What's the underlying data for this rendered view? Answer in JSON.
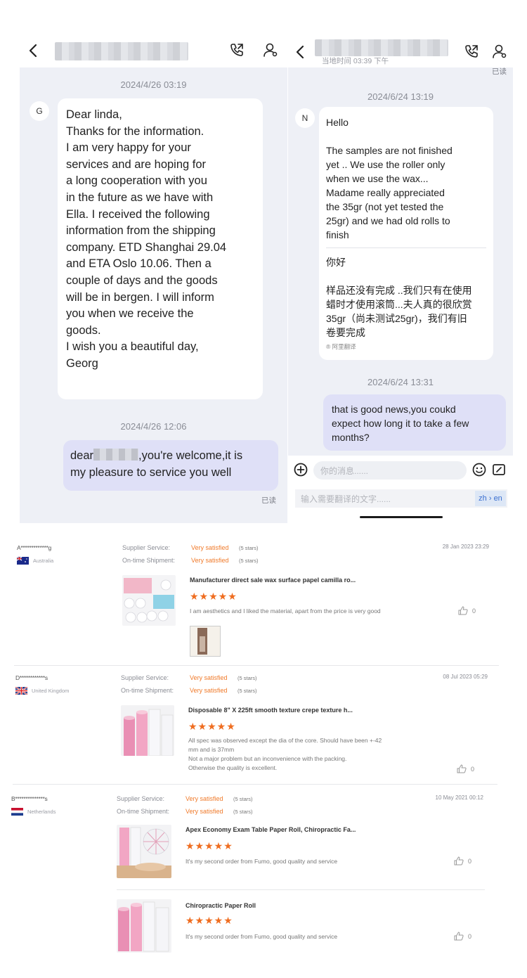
{
  "left_chat": {
    "avatar_initial": "G",
    "msg1_time": "2024/4/26 03:19",
    "msg1_text": "Dear linda,\nThanks for the information.\nI am very happy for your\nservices and are hoping for\na long cooperation with you\nin the future as we have with\nElla. I received the following\ninformation from the shipping\ncompany. ETD Shanghai 29.04\nand ETA Oslo 10.06. Then a\ncouple of days and the goods\nwill be in bergen. I will inform\nyou when we receive the\ngoods.\nI wish you a beautiful day,\nGeorg",
    "msg2_time": "2024/4/26 12:06",
    "msg2_prefix": "dear",
    "msg2_rest": ",you're welcome,it is",
    "msg2_line2": "my pleasure to service you well",
    "read_label": "已读"
  },
  "right_chat": {
    "sub_header": "当地时间 03:39 下午",
    "read_label_top": "已读",
    "avatar_initial": "N",
    "msg1_time": "2024/6/24 13:19",
    "msg1_en": "Hello\n\nThe samples are not finished\nyet .. We use the roller only\nwhen we use the wax...\nMadame really appreciated\nthe 35gr (not yet tested the\n25gr) and we had old rolls to\nfinish",
    "msg1_zh": "你好\n\n样品还没有完成 ..我们只有在使用\n蜡时才使用滚筒...夫人真的很欣赏\n35gr（尚未测试25gr)，我们有旧\n卷要完成",
    "translate_tag": "® 阿里翻译",
    "msg2_time": "2024/6/24 13:31",
    "msg2_text": "that is good news,you coukd\nexpect how long it to take a few\nmonths?",
    "input_placeholder": "你的消息......",
    "translate_placeholder": "输入需要翻译的文字......",
    "lang_toggle": "zh › en"
  },
  "reviews": [
    {
      "name": "A*************g",
      "country": "Australia",
      "supplier_label": "Supplier Service:",
      "supplier_value": "Very satisfied",
      "supplier_stars": "(5 stars)",
      "shipment_label": "On-time Shipment:",
      "shipment_value": "Very satisfied",
      "shipment_stars": "(5 stars)",
      "date": "28 Jan 2023 23:29",
      "product": "Manufacturer direct sale wax surface papel camilla ro...",
      "stars": "★★★★★",
      "text": "I am aesthetics and I liked the material, apart from the price is very good",
      "likes": "0"
    },
    {
      "name": "D************s",
      "country": "United Kingdom",
      "supplier_label": "Supplier Service:",
      "supplier_value": "Very satisfied",
      "supplier_stars": "(5 stars)",
      "shipment_label": "On-time Shipment:",
      "shipment_value": "Very satisfied",
      "shipment_stars": "(5 stars)",
      "date": "08 Jul 2023 05:29",
      "product": "Disposable 8\" X 225ft smooth texture crepe texture h...",
      "stars": "★★★★★",
      "text": "All spec was observed except the dia of the core. Should have been +-42\nmm and is 37mm\nNot a major problem but an inconvenience with the packing.\nOtherwise the quality is excellent.",
      "likes": "0"
    },
    {
      "name": "B**************s",
      "country": "Netherlands",
      "supplier_label": "Supplier Service:",
      "supplier_value": "Very satisfied",
      "supplier_stars": "(5 stars)",
      "shipment_label": "On-time Shipment:",
      "shipment_value": "Very satisfied",
      "shipment_stars": "(5 stars)",
      "date": "10 May 2021 00:12",
      "product": "Apex Economy Exam Table Paper Roll, Chiropractic Fa...",
      "stars": "★★★★★",
      "text": "It's my second order from Fumo, good quality and service",
      "likes": "0",
      "product2": "Chiropractic Paper Roll",
      "stars2": "★★★★★",
      "text2": "It's my second order from Fumo, good quality and service",
      "likes2": "0"
    }
  ],
  "icons": {
    "back": "chevron-left-icon",
    "call": "phone-icon",
    "profile": "person-icon",
    "plus": "plus-circle-icon",
    "emoji": "emoji-icon",
    "edit": "edit-icon",
    "like": "thumbs-up-icon"
  },
  "colors": {
    "chat_bg": "#eef0f6",
    "bubble_out": "#dfe0f7",
    "accent_orange": "#ef6d20"
  }
}
